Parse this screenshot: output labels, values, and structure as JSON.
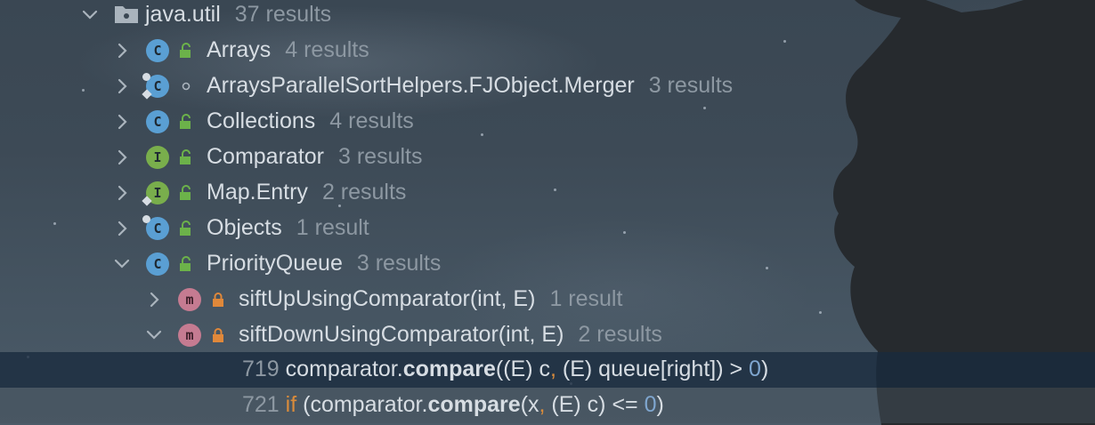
{
  "colors": {
    "class_icon": "#5a9fd3",
    "interface_icon": "#79ae4c",
    "method_icon": "#c57b91",
    "public_lock": "#6cb24a",
    "private_lock": "#e0883a",
    "keyword": "#d98b3b",
    "number": "#7fa6cf",
    "selected_row": "#182a3e"
  },
  "tree": {
    "package": {
      "name": "java.util",
      "count": "37 results",
      "expanded": true,
      "icon": "folder-icon"
    },
    "classes": [
      {
        "name": "Arrays",
        "count": "4 results",
        "kind": "C",
        "expanded": false,
        "visibility": "public"
      },
      {
        "name": "ArraysParallelSortHelpers.FJObject.Merger",
        "count": "3 results",
        "kind": "C",
        "expanded": false,
        "visibility": "package-private"
      },
      {
        "name": "Collections",
        "count": "4 results",
        "kind": "C",
        "expanded": false,
        "visibility": "public"
      },
      {
        "name": "Comparator",
        "count": "3 results",
        "kind": "I",
        "expanded": false,
        "visibility": "public"
      },
      {
        "name": "Map.Entry",
        "count": "2 results",
        "kind": "I",
        "expanded": false,
        "visibility": "public"
      },
      {
        "name": "Objects",
        "count": "1 result",
        "kind": "C",
        "expanded": false,
        "visibility": "public"
      },
      {
        "name": "PriorityQueue",
        "count": "3 results",
        "kind": "C",
        "expanded": true,
        "visibility": "public"
      }
    ],
    "methods": [
      {
        "name": "siftUpUsingComparator(int, E)",
        "count": "1 result",
        "kind": "m",
        "expanded": false,
        "visibility": "private"
      },
      {
        "name": "siftDownUsingComparator(int, E)",
        "count": "2 results",
        "kind": "m",
        "expanded": true,
        "visibility": "private"
      }
    ],
    "usages": [
      {
        "line": "719",
        "pre": "comparator.",
        "bold": "compare",
        "mid1": "((E) c",
        "comma": ",",
        "mid2": " (E) queue[right]) > ",
        "num": "0",
        "post": ")"
      },
      {
        "line": "721",
        "kw": "if",
        "pre": " (comparator.",
        "bold": "compare",
        "mid1": "(x",
        "comma": ",",
        "mid2": " (E) c) <= ",
        "num": "0",
        "post": ")"
      }
    ]
  }
}
